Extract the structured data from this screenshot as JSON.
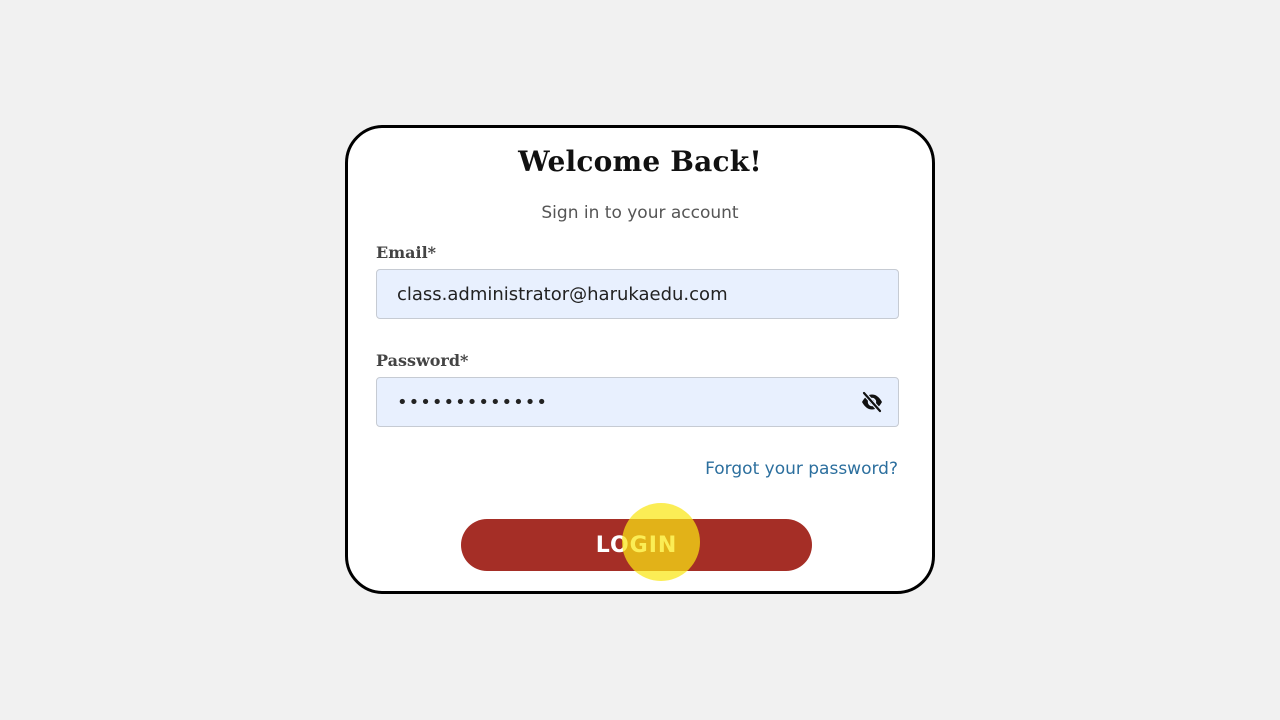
{
  "login": {
    "title": "Welcome Back!",
    "subtitle": "Sign in to your account",
    "email_label": "Email*",
    "email_value": "class.administrator@harukaedu.com",
    "password_label": "Password*",
    "password_value": "•••••••••••••",
    "forgot_link": "Forgot your password?",
    "login_button": "LOGIN"
  },
  "icons": {
    "password_toggle": "eye-slash-icon"
  },
  "colors": {
    "page_background": "#f1f1f1",
    "card_border": "#000000",
    "input_background": "#e8f0fe",
    "link": "#2c6f9e",
    "button": "#a52e26",
    "cursor_highlight": "#fae614"
  }
}
